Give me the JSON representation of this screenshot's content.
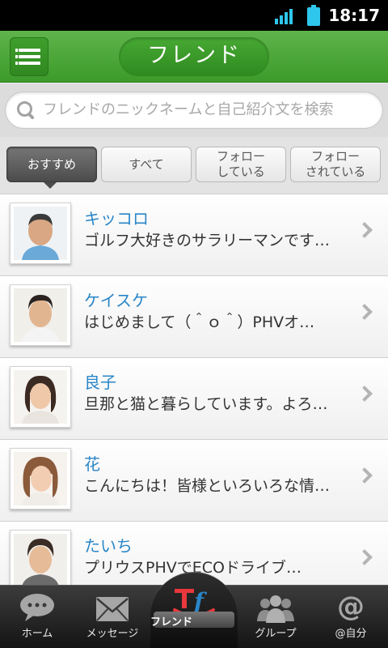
{
  "status_bar": {
    "time": "18:17",
    "signal_icon": "signal-icon",
    "battery_icon": "battery-icon"
  },
  "header": {
    "title": "フレンド",
    "menu_icon": "hamburger-menu-icon",
    "accent": "#3c9a2a"
  },
  "search": {
    "placeholder": "フレンドのニックネームと自己紹介文を検索"
  },
  "tabs": [
    {
      "label": "おすすめ",
      "active": true
    },
    {
      "label": "すべて",
      "active": false
    },
    {
      "label": "フォロー\nしている",
      "active": false
    },
    {
      "label": "フォロー\nされている",
      "active": false
    }
  ],
  "friends": [
    {
      "name": "キッコロ",
      "intro": "ゴルフ大好きのサラリーマンです…"
    },
    {
      "name": "ケイスケ",
      "intro": "はじめまして（＾ｏ＾）PHVオ…"
    },
    {
      "name": "良子",
      "intro": "旦那と猫と暮らしています。よろ…"
    },
    {
      "name": "花",
      "intro": "こんにちは！皆様といろいろな情…"
    },
    {
      "name": "たいち",
      "intro": "プリウスPHVでECOドライブ…"
    }
  ],
  "bottom_nav": [
    {
      "label": "ホーム",
      "icon": "speech-bubble-icon",
      "active": false
    },
    {
      "label": "メッセージ",
      "icon": "envelope-icon",
      "active": false
    },
    {
      "label": "フレンド",
      "icon": "tf-logo-icon",
      "active": true
    },
    {
      "label": "グループ",
      "icon": "group-people-icon",
      "active": false
    },
    {
      "label": "@自分",
      "icon": "at-sign-icon",
      "active": false
    }
  ]
}
